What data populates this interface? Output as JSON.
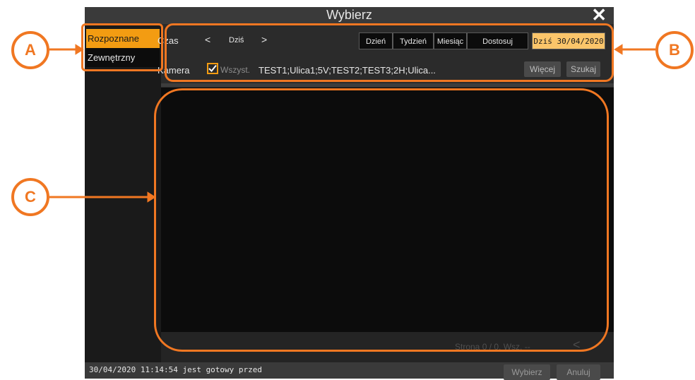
{
  "dialog": {
    "title": "Wybierz",
    "close_icon": "close-icon"
  },
  "sidebar": {
    "items": [
      {
        "label": "Rozpoznane",
        "active": true
      },
      {
        "label": "Zewnętrzny",
        "active": false
      }
    ]
  },
  "filters": {
    "time_label": "Czas",
    "prev": "<",
    "date_label": "Dziś",
    "next": ">",
    "ranges": [
      "Dzień",
      "Tydzień",
      "Miesiąc",
      "Dostosuj"
    ],
    "active_range": "Dziś 30/04/2020",
    "camera_label": "Kamera",
    "all_label": "Wszyst.",
    "all_checked": true,
    "camera_list": "TEST1;Ulica1;5V;TEST2;TEST3;2H;Ulica...",
    "more_button": "Więcej",
    "search_button": "Szukaj"
  },
  "pager": {
    "text": "Strona 0 / 0, Wsz. --",
    "prev": "<"
  },
  "footer": {
    "status": "30/04/2020 11:14:54 jest gotowy przed",
    "select_button": "Wybierz",
    "cancel_button": "Anuluj"
  },
  "annotations": {
    "a": "A",
    "b": "B",
    "c": "C"
  },
  "colors": {
    "accent": "#f39c12",
    "callout": "#f07722",
    "active_range_bg": "#fbc56a"
  }
}
